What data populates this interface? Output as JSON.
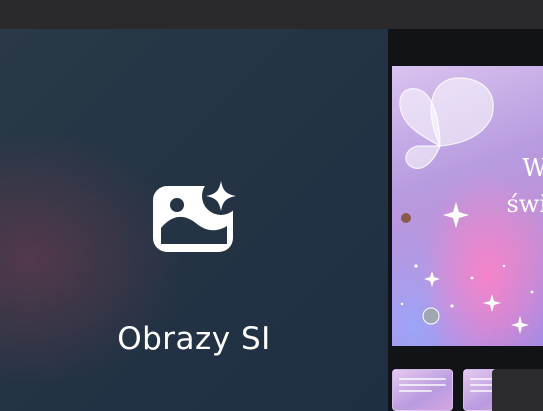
{
  "tile": {
    "label": "Obrazy SI",
    "icon": "ai-image-sparkle-icon"
  },
  "preview": {
    "text_line_1": "W",
    "text_line_2": "świ"
  },
  "colors": {
    "tile_background": "#243445",
    "preview_accent": "#c28ed6"
  }
}
